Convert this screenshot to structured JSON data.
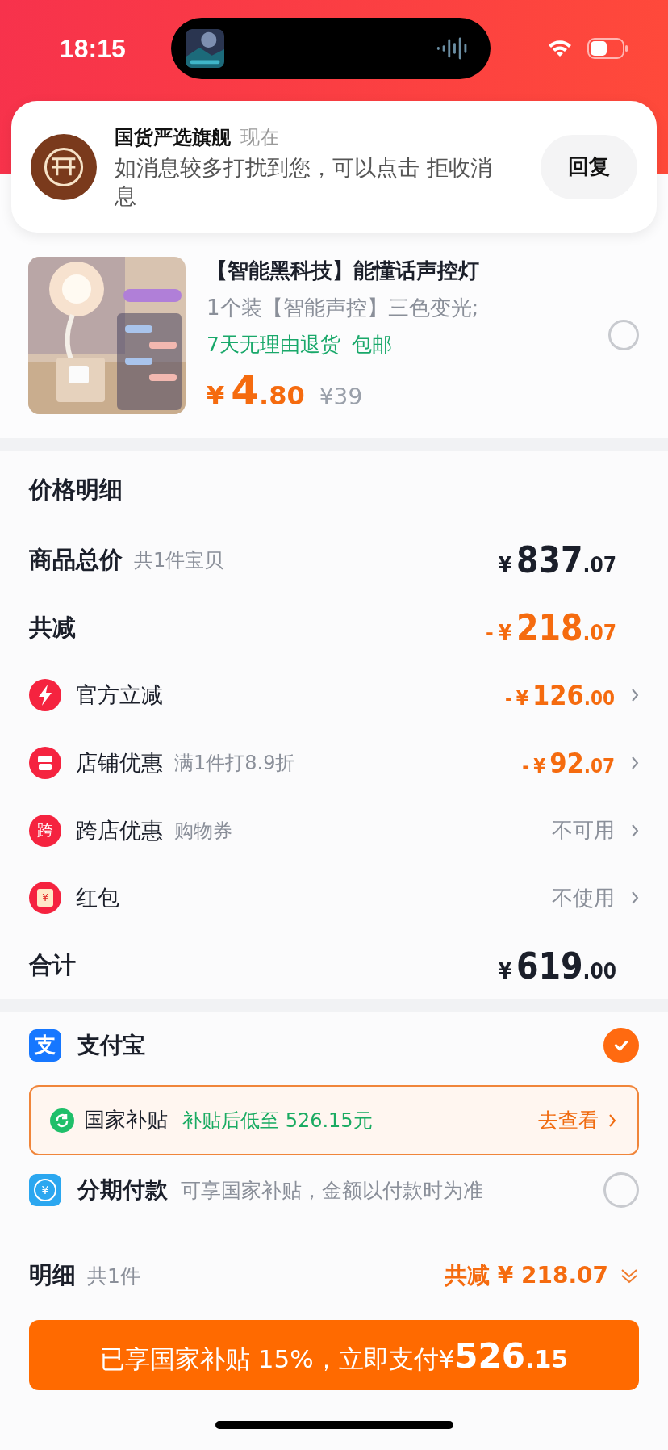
{
  "status_bar": {
    "time": "18:15"
  },
  "notification": {
    "sender": "国货严选旗舰",
    "time": "现在",
    "message": "如消息较多打扰到您，可以点击 拒收消息",
    "reply_button": "回复"
  },
  "product": {
    "title": "【智能黑科技】能懂话声控灯",
    "spec": "1个装【智能声控】三色变光;",
    "tags": [
      "7天无理由退货",
      "包邮"
    ],
    "currency": "¥",
    "price_int": "4",
    "price_dec": ".80",
    "original_price": "¥39",
    "selected": false
  },
  "price_detail": {
    "title": "价格明细",
    "rows": [
      {
        "kind": "summary",
        "label": "商品总价",
        "note": "共1件宝贝",
        "currency": "¥",
        "int": "837",
        "dec": ".07"
      },
      {
        "kind": "summary",
        "label": "共减",
        "prefix": "-",
        "currency": "¥",
        "int": "218",
        "dec": ".07"
      },
      {
        "kind": "discount",
        "label": "官方立减",
        "prefix": "-",
        "currency": "¥",
        "int": "126",
        "dec": ".00"
      },
      {
        "kind": "discount",
        "label": "店铺优惠",
        "note": "满1件打8.9折",
        "prefix": "-",
        "currency": "¥",
        "int": "92",
        "dec": ".07"
      },
      {
        "kind": "option",
        "icon_text": "跨",
        "label": "跨店优惠",
        "note": "购物券",
        "value": "不可用"
      },
      {
        "kind": "option",
        "icon_text": "¥",
        "label": "红包",
        "value": "不使用"
      },
      {
        "kind": "summary",
        "label": "合计",
        "currency": "¥",
        "int": "619",
        "dec": ".00"
      }
    ]
  },
  "payment": {
    "methods": [
      {
        "kind": "alipay",
        "icon_text": "支",
        "name": "支付宝",
        "selected": true,
        "subsidy": {
          "label": "国家补贴",
          "text": "补贴后低至 526.15元",
          "link": "去查看"
        }
      },
      {
        "kind": "installment",
        "icon_text": "¥",
        "name": "分期付款",
        "note": "可享国家补贴，金额以付款时为准",
        "selected": false
      }
    ]
  },
  "footer": {
    "label": "明细",
    "count": "共1件",
    "discount": "共减 ¥ 218.07",
    "pay_button": {
      "text": "已享国家补贴 15%，立即支付¥",
      "int": "526",
      "dec": ".15"
    }
  }
}
